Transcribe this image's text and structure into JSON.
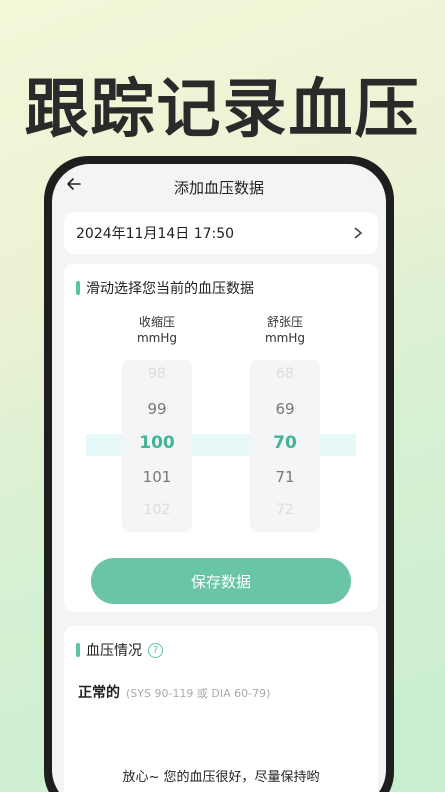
{
  "headline": "跟踪记录血压",
  "header": {
    "title": "添加血压数据",
    "back_icon": "arrow-left-icon"
  },
  "datetime": {
    "value": "2024年11月14日 17:50",
    "icon": "chevron-right-icon"
  },
  "picker": {
    "section_title": "滑动选择您当前的血压数据",
    "systolic": {
      "label": "收缩压",
      "unit": "mmHg",
      "values": [
        "98",
        "99",
        "100",
        "101",
        "102"
      ],
      "selected": "100"
    },
    "diastolic": {
      "label": "舒张压",
      "unit": "mmHg",
      "values": [
        "68",
        "69",
        "70",
        "71",
        "72"
      ],
      "selected": "70"
    },
    "save_label": "保存数据"
  },
  "status": {
    "section_title": "血压情况",
    "help_icon": "question-circle-icon",
    "label": "正常的",
    "range": "(SYS 90-119 或 DIA 60-79)",
    "message": "放心~ 您的血压很好，尽量保持哟"
  },
  "colors": {
    "accent": "#6ac4a6",
    "selected_text": "#41b594",
    "highlight": "#e6f8f7"
  }
}
